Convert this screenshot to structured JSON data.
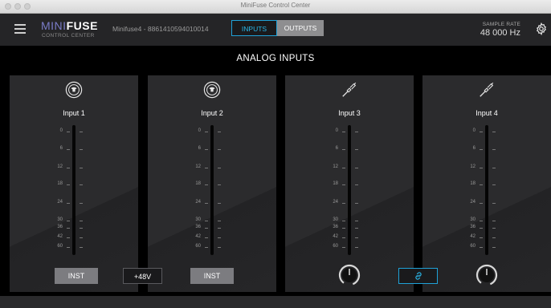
{
  "window": {
    "title": "MiniFuse Control Center"
  },
  "header": {
    "logo_prefix": "MINI",
    "logo_bold": "FUSE",
    "logo_sub": "CONTROL CENTER",
    "device": "Minifuse4 - 8861410594010014",
    "tabs": [
      {
        "label": "INPUTS",
        "active": true
      },
      {
        "label": "OUTPUTS",
        "active": false
      }
    ],
    "sample_rate_label": "SAMPLE RATE",
    "sample_rate_value": "48 000 Hz"
  },
  "section_title": "ANALOG INPUTS",
  "scale_labels": [
    "0",
    "6",
    "12",
    "18",
    "24",
    "30",
    "36",
    "42",
    "60"
  ],
  "channels": [
    {
      "label": "Input 1",
      "icon": "xlr-combo-jack-icon"
    },
    {
      "label": "Input 2",
      "icon": "xlr-combo-jack-icon"
    },
    {
      "label": "Input 3",
      "icon": "jack-cable-icon"
    },
    {
      "label": "Input 4",
      "icon": "jack-cable-icon"
    }
  ],
  "controls": {
    "inst_1": "INST",
    "phantom": "+48V",
    "inst_2": "INST",
    "link_icon": "link-icon"
  },
  "colors": {
    "accent": "#1fa2d8",
    "header_bg": "#252527",
    "panel_bg": "#2b2b2d",
    "button_gray": "#7c7c80"
  }
}
